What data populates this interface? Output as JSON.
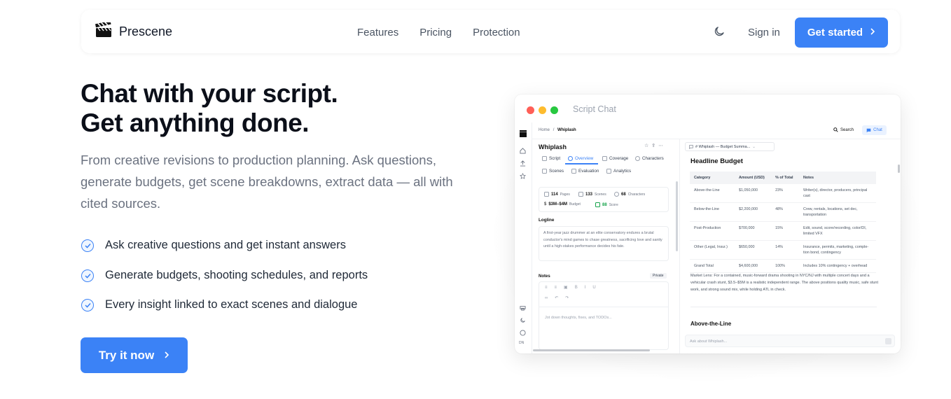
{
  "nav": {
    "brand": "Prescene",
    "links": [
      "Features",
      "Pricing",
      "Protection"
    ],
    "signin": "Sign in",
    "cta": "Get started"
  },
  "hero": {
    "title_line1": "Chat with your script.",
    "title_line2": "Get anything done.",
    "subtitle": "From creative revisions to production planning. Ask questions, generate budgets, get scene breakdowns, extract data — all with cited sources.",
    "features": [
      "Ask creative questions and get instant answers",
      "Generate budgets, shooting schedules, and reports",
      "Every insight linked to exact scenes and dialogue"
    ],
    "cta": "Try it now"
  },
  "colors": {
    "accent": "#3b82f6",
    "dot_red": "#ff5f57",
    "dot_yellow": "#febc2e",
    "dot_green": "#28c840"
  },
  "app": {
    "window_title": "Script Chat",
    "breadcrumb_home": "Home",
    "breadcrumb_sep": "/",
    "breadcrumb_current": "Whiplash",
    "search": "Search",
    "chat": "Chat",
    "project_title": "Whiplash",
    "tabs": [
      "Script",
      "Overview",
      "Coverage",
      "Characters",
      "Scenes",
      "Evaluation",
      "Analytics"
    ],
    "stats": {
      "pages_value": "114",
      "pages_label": "Pages",
      "scenes_value": "133",
      "scenes_label": "Scenes",
      "characters_value": "68",
      "characters_label": "Characters",
      "budget_value": "$3M–$4M",
      "budget_label": "Budget",
      "score_value": "88",
      "score_label": "Score"
    },
    "logline_label": "Logline",
    "logline": "A first-year jazz drummer at an elite conservatory endures a brutal conductor's mind games to chase greatness, sacrificing love and sanity until a high-stakes performance decides his fate.",
    "notes_label": "Notes",
    "notes_private": "Private",
    "notes_placeholder": "Jot down thoughts, fixes, and TODOs...",
    "chat_selector": "# Whiplash — Budget Summa...",
    "budget_heading": "Headline Budget",
    "budget_columns": [
      "Category",
      "Amount (USD)",
      "% of Total",
      "Notes"
    ],
    "budget_rows": [
      [
        "Above-the-Line",
        "$1,050,000",
        "23%",
        "Writer(s), director, producers, principal cast"
      ],
      [
        "Below-the-Line",
        "$2,200,000",
        "48%",
        "Crew, rentals, locations, set dec, transportation"
      ],
      [
        "Post-Production",
        "$700,000",
        "15%",
        "Edit, sound, score/recording, color/DI, limited VFX"
      ],
      [
        "Other (Legal, Insur.)",
        "$650,000",
        "14%",
        "Insurance, permits, marketing, comple-tion bond, contingency"
      ],
      [
        "Grand Total",
        "$4,600,000",
        "100%",
        "Includes 10% contingency + overhead"
      ]
    ],
    "market_lens": "Market Lens: For a contained, music-forward drama shooting in NYC/NJ with multiple concert days and a vehicular crash stunt, $3.5–$5M is a realistic independent range. The above positions quality music, safe stunt work, and strong sound mix, while holding ATL in check.",
    "section2": "Above-the-Line",
    "ask_placeholder": "Ask about Whiplash...",
    "rail_badge": "DN"
  }
}
